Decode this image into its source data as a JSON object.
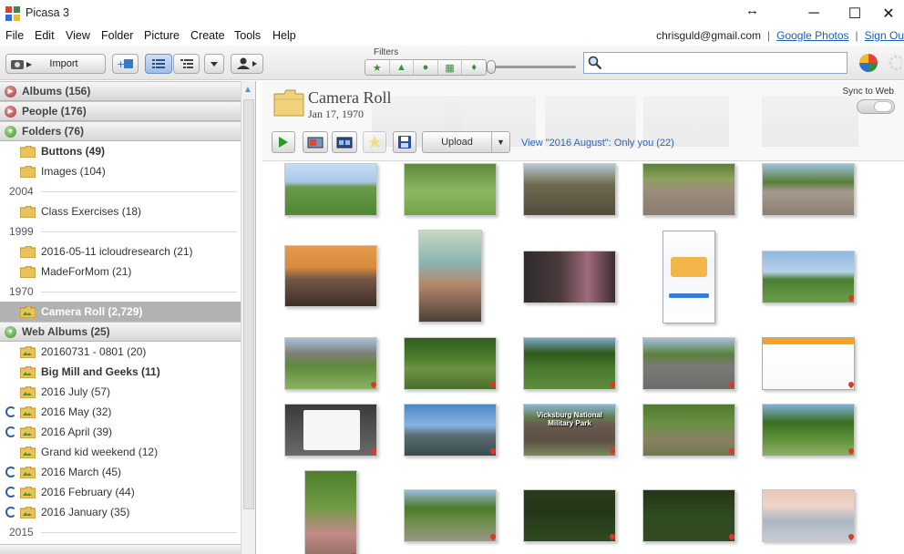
{
  "window": {
    "title": "Picasa 3",
    "restore_glyph": "↔",
    "minimize_glyph": "─",
    "maximize_glyph": "☐",
    "close_glyph": "✕"
  },
  "menu": [
    "File",
    "Edit",
    "View",
    "Folder",
    "Picture",
    "Create",
    "Tools",
    "Help"
  ],
  "account": {
    "email": "chrisguld@gmail.com",
    "separator": "|",
    "google_photos": "Google Photos",
    "sign_out": "Sign Ou"
  },
  "toolbar": {
    "import_label": "Import",
    "filters_label": "Filters",
    "search_placeholder": ""
  },
  "sidebar": {
    "albums": "Albums (156)",
    "people": "People (176)",
    "folders": "Folders (76)",
    "folder_items": [
      "Buttons (49)",
      "Images (104)"
    ],
    "year_2004": "2004",
    "class_exercises": "Class Exercises (18)",
    "year_1999": "1999",
    "year_1999_items": [
      "2016-05-11 icloudresearch (21)",
      "MadeForMom (21)"
    ],
    "year_1970": "1970",
    "camera_roll": "Camera Roll (2,729)",
    "web_albums": "Web Albums (25)",
    "web_items": [
      "20160731 - 0801 (20)",
      "Big Mill and Geeks (11)",
      "2016 July (57)",
      "2016 May (32)",
      "2016 April (39)",
      "Grand kid weekend (12)",
      "2016 March (45)",
      "2016 February (44)",
      "2016 January (35)"
    ],
    "year_2015": "2015"
  },
  "album": {
    "title": "Camera Roll",
    "date": "Jan 17, 1970",
    "sync_label": "Sync to Web",
    "upload_label": "Upload",
    "view_link": "View \"2016 August\": Only you (22)"
  },
  "photo_texts": {
    "vicksburg": "Vicksburg National Military Park"
  }
}
